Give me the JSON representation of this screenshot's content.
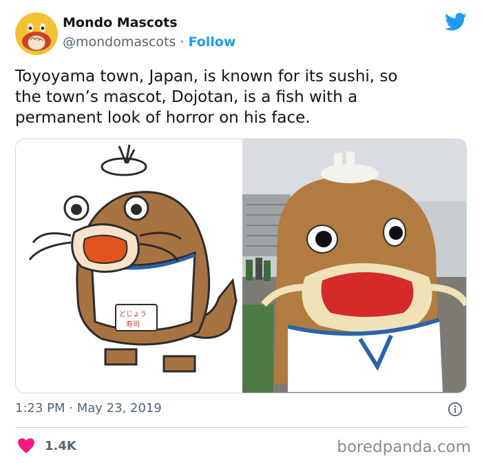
{
  "author": {
    "name": "Mondo Mascots",
    "handle": "@mondomascots",
    "separator": "·",
    "follow_label": "Follow",
    "avatar_icon": "hand-over-mouth-emoji"
  },
  "tweet": {
    "text": "Toyoyama town, Japan, is known for its sushi, so\nthe town’s mascot, Dojotan, is a fish with a\npermanent look of horror on his face.",
    "time": "1:23 PM",
    "date": "May 23, 2019",
    "time_separator": "·"
  },
  "media": {
    "left_image": "cartoon-illustration-of-dojotan",
    "right_image": "photo-of-dojotan-costume",
    "badge_text": "どじょう 寿司"
  },
  "engagement": {
    "likes": "1.4K"
  },
  "watermark": "boredpanda.com",
  "colors": {
    "accent": "#1d9bf0",
    "heart": "#f91880",
    "text": "#0f1419",
    "secondary": "#536471"
  }
}
